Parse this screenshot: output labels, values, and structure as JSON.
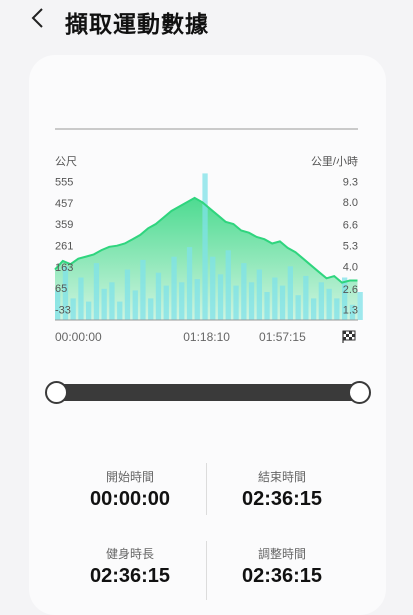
{
  "header": {
    "back_icon": "chevron-left-icon",
    "title": "擷取運動數據"
  },
  "chart": {
    "left_unit": "公尺",
    "right_unit": "公里/小時",
    "finish_icon": "checkered-flag-icon"
  },
  "colors": {
    "elevation_top": "#2fd57e",
    "elevation_bottom": "#c8f3dc",
    "speed": "#7fe2e8",
    "slider_track": "#3a3a3a",
    "axis_line": "#999999"
  },
  "stats": {
    "start_label": "開始時間",
    "start_value": "00:00:00",
    "end_label": "結束時間",
    "end_value": "02:36:15",
    "workout_duration_label": "健身時長",
    "workout_duration_value": "02:36:15",
    "adjust_time_label": "調整時間",
    "adjust_time_value": "02:36:15"
  },
  "trim_range": {
    "start_fraction": 0.0,
    "end_fraction": 1.0
  },
  "chart_data": {
    "type": "area",
    "x_label": "",
    "x_ticks": [
      "00:00:00",
      "01:18:10",
      "01:57:15"
    ],
    "x_range": [
      "00:00:00",
      "02:36:15"
    ],
    "y_left_label": "公尺",
    "y_left_ticks": [
      555,
      457,
      359,
      261,
      163,
      65,
      -33
    ],
    "y_left_range": [
      -82,
      604
    ],
    "y_right_label": "公里/小時",
    "y_right_ticks": [
      "9.3",
      "8.0",
      "6.6",
      "5.3",
      "4.0",
      "2.6",
      "1.3"
    ],
    "y_right_range": [
      0.65,
      9.95
    ],
    "series": [
      {
        "name": "公尺",
        "type": "area",
        "axis": "left",
        "x_minutes": [
          0,
          4,
          8,
          12,
          16,
          20,
          24,
          28,
          32,
          36,
          40,
          44,
          48,
          52,
          56,
          60,
          64,
          68,
          72,
          76,
          80,
          84,
          88,
          92,
          96,
          100,
          104,
          108,
          112,
          116,
          120,
          124,
          128,
          132,
          136,
          140,
          144,
          148,
          152,
          156
        ],
        "values": [
          150,
          190,
          175,
          200,
          210,
          220,
          240,
          255,
          260,
          270,
          290,
          310,
          340,
          360,
          390,
          420,
          440,
          460,
          480,
          460,
          430,
          400,
          370,
          360,
          330,
          320,
          300,
          290,
          270,
          280,
          250,
          230,
          200,
          170,
          140,
          110,
          120,
          90,
          100,
          100
        ]
      },
      {
        "name": "公里/小時",
        "type": "bar",
        "axis": "right",
        "x_minutes": [
          0,
          4,
          8,
          12,
          16,
          20,
          24,
          28,
          32,
          36,
          40,
          44,
          48,
          52,
          56,
          60,
          64,
          68,
          72,
          76,
          80,
          84,
          88,
          92,
          96,
          100,
          104,
          108,
          112,
          116,
          120,
          124,
          128,
          132,
          136,
          140,
          144,
          148,
          152,
          156
        ],
        "values": [
          2.5,
          4.0,
          2.0,
          3.3,
          1.8,
          4.2,
          2.6,
          3.0,
          1.8,
          3.8,
          2.5,
          4.4,
          2.0,
          3.6,
          2.8,
          4.6,
          3.0,
          5.2,
          3.2,
          9.8,
          4.6,
          3.5,
          5.0,
          2.8,
          4.2,
          3.0,
          3.8,
          2.4,
          3.3,
          2.8,
          4.0,
          2.2,
          3.4,
          2.0,
          3.0,
          2.6,
          2.0,
          3.3,
          1.6,
          2.4
        ]
      }
    ]
  }
}
